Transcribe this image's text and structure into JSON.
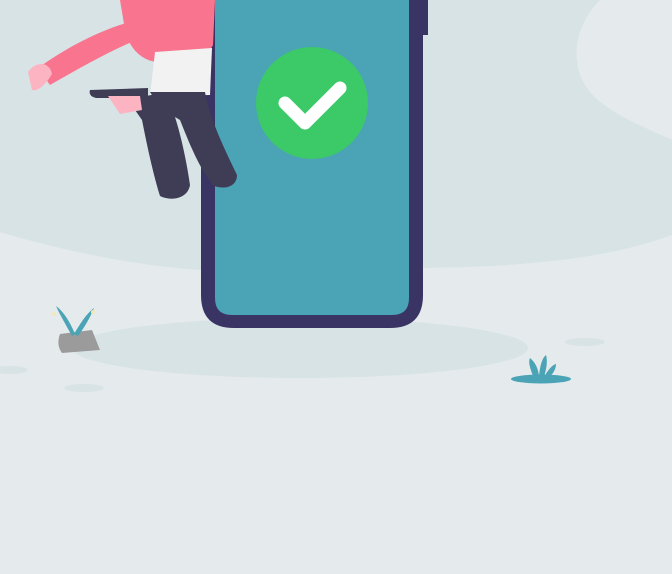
{
  "illustration": {
    "subject": "person-jumping-beside-phone-with-success-check",
    "icons": [
      "checkmark-icon",
      "phone-icon",
      "plant-icon",
      "rock-icon"
    ],
    "colors": {
      "background": "#e5eaec",
      "blob": "#d8e3e6",
      "phone_frame": "#3a3464",
      "phone_screen": "#4ba3b6",
      "check_circle": "#3cc968",
      "check_mark": "#ffffff",
      "shirt": "#f9748f",
      "pants": "#3f3d56",
      "plant": "#4ba3b6",
      "rock": "#9b9b9b"
    }
  }
}
